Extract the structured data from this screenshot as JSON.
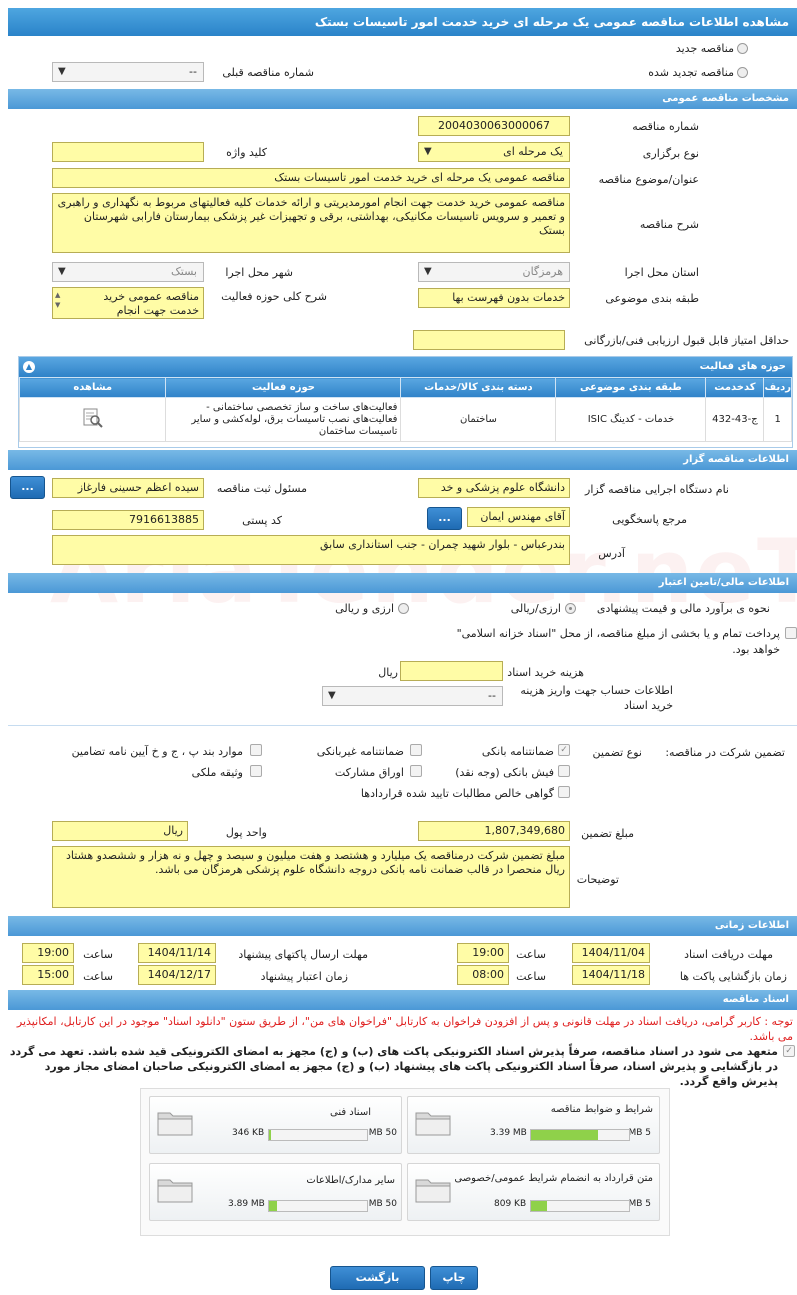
{
  "header": {
    "title": "مشاهده اطلاعات مناقصه عمومی یک مرحله ای خرید خدمت امور تاسیسات بستک"
  },
  "top": {
    "new_label": "مناقصه جدید",
    "renewed_label": "مناقصه تجدید شده",
    "prev_number_label": "شماره مناقصه قبلی",
    "prev_number_value": "--"
  },
  "general": {
    "section_title": "مشخصات مناقصه عمومی",
    "number_label": "شماره مناقصه",
    "number_value": "2004030063000067",
    "type_label": "نوع برگزاری",
    "type_value": "یک مرحله ای",
    "keyword_label": "کلید واژه",
    "keyword_value": "",
    "subject_label": "عنوان/موضوع مناقصه",
    "subject_value": "مناقصه عمومی یک مرحله ای خرید خدمت امور تاسیسات بستک",
    "desc_label": "شرح مناقصه",
    "desc_value": "مناقصه عمومی خرید خدمت جهت انجام امورمدیریتی و ارائه خدمات کلیه فعالیتهای مربوط به  نگهداری و راهبری و تعمیر و سرویس تاسیسات مکانیکی، بهداشتی، برقی و تجهیزات غیر پزشکی بیمارستان فارابی شهرستان بستک",
    "province_label": "استان محل اجرا",
    "province_value": "هرمزگان",
    "city_label": "شهر محل اجرا",
    "city_value": "بستک",
    "category_label": "طبقه بندی موضوعی",
    "category_value": "خدمات بدون فهرست بها",
    "scope_label": "شرح کلی حوزه فعالیت",
    "scope_value": "مناقصه عمومی خرید خدمت جهت انجام",
    "min_score_label": "حداقل امتیاز قابل قبول ارزیابی فنی/بازرگانی",
    "min_score_value": ""
  },
  "activity": {
    "title": "حوزه های فعالیت",
    "columns": [
      "ردیف",
      "کدخدمت",
      "طبقه بندی موضوعی",
      "دسته بندی کالا/خدمات",
      "حوزه فعالیت",
      "مشاهده"
    ],
    "rows": [
      {
        "index": "1",
        "code": "ج-43-432",
        "category": "خدمات - کدینگ ISIC",
        "group": "ساختمان",
        "field": "فعالیت‌های ساخت و ساز تخصصی ساختمانی - فعالیت‌های نصب تاسیسات برق، لوله‌کشی و سایر تاسیسات ساختمان"
      }
    ]
  },
  "organizer": {
    "section_title": "اطلاعات مناقصه گزار",
    "agency_label": "نام دستگاه اجرایی مناقصه گزار",
    "agency_value": "دانشگاه علوم پزشکی و خد",
    "registrar_label": "مسئول ثبت مناقصه",
    "registrar_value": "سیده اعظم حسینی فارغاز",
    "ref_label": "مرجع پاسخگویی",
    "ref_value": "آقای مهندس ایمان",
    "postal_label": "کد پستی",
    "postal_value": "7916613885",
    "address_label": "آدرس",
    "address_value": "بندرعباس - بلوار شهید چمران - جنب استانداری سابق",
    "more_btn": "..."
  },
  "finance": {
    "section_title": "اطلاعات مالی/تامین اعتبار",
    "estimate_label": "نحوه ی برآورد مالی و قیمت پیشنهادی",
    "opt_rial": "ارزی/ریالی",
    "opt_mixed": "ارزی و ریالی",
    "treasury_text": "پرداخت تمام و یا بخشی از مبلغ مناقصه، از محل \"اسناد خزانه اسلامی\" خواهد بود.",
    "doc_cost_label": "هزینه خرید اسناد",
    "doc_cost_value": "",
    "doc_cost_unit": "ریال",
    "account_label": "اطلاعات حساب جهت واریز هزینه خرید اسناد",
    "account_value": "--"
  },
  "guarantee": {
    "label": "تضمین شرکت در مناقصه:",
    "type_label": "نوع تضمین",
    "options": [
      "ضمانتنامه بانکی",
      "ضمانتنامه غیربانکی",
      "موارد بند پ ، ج و خ آیین نامه تضامین",
      "فیش بانکی (وجه نقد)",
      "اوراق مشارکت",
      "وثیقه ملکی",
      "گواهی خالص مطالبات تایید شده قراردادها"
    ],
    "amount_label": "مبلغ تضمین",
    "amount_value": "1,807,349,680",
    "currency_label": "واحد پول",
    "currency_value": "ریال",
    "notes_label": "توضیحات",
    "notes_value": "مبلغ تضمین شرکت درمناقصه یک میلیارد و هشتصد و هفت میلیون و سیصد و چهل و نه هزار و ششصدو هشتاد ریال منحصرا در قالب ضمانت نامه بانکی دروجه دانشگاه علوم پزشکی هرمزگان می باشد."
  },
  "timing": {
    "section_title": "اطلاعات زمانی",
    "receive_label": "مهلت دریافت اسناد",
    "receive_date": "1404/11/04",
    "receive_time": "19:00",
    "submit_label": "مهلت ارسال پاکتهای پیشنهاد",
    "submit_date": "1404/11/14",
    "submit_time": "19:00",
    "open_label": "زمان بازگشایی پاکت ها",
    "open_date": "1404/11/18",
    "open_time": "08:00",
    "valid_label": "زمان اعتبار پیشنهاد",
    "valid_date": "1404/12/17",
    "valid_time": "15:00",
    "time_label": "ساعت"
  },
  "docs": {
    "section_title": "اسناد مناقصه",
    "notice": "توجه : کاربر گرامی، دریافت اسناد در مهلت قانونی و پس از افزودن فراخوان به کارتابل \"فراخوان های من\"، از طریق ستون \"دانلود اسناد\" موجود در این کارتابل، امکانپذیر می باشد.",
    "commit": "متعهد می شود در اسناد مناقصه، صرفاً پذیرش اسناد الکترونیکی پاکت های (ب) و (ج) مجهز به امضای الکترونیکی قید شده باشد. تعهد می گردد در بازگشایی و پذیرش اسناد، صرفاً اسناد الکترونیکی پاکت های پیشنهاد (ب) و (ج) مجهز به امضای الکترونیکی صاحبان امضای مجاز مورد پذیرش واقع گردد.",
    "cards": [
      {
        "title": "شرایط و ضوابط مناقصه",
        "used": "3.39 MB",
        "limit": "5 MB",
        "ratio": 0.68
      },
      {
        "title": "اسناد فنی",
        "used": "346 KB",
        "limit": "50 MB",
        "ratio": 0.01
      },
      {
        "title": "متن قرارداد به انضمام شرایط عمومی/خصوصی",
        "used": "809 KB",
        "limit": "5 MB",
        "ratio": 0.16
      },
      {
        "title": "سایر مدارک/اطلاعات",
        "used": "3.89 MB",
        "limit": "50 MB",
        "ratio": 0.08
      }
    ]
  },
  "footer": {
    "print": "چاپ",
    "back": "بازگشت"
  },
  "watermark": "AriaTender.neT",
  "colors": {
    "header": "#2a83c9",
    "field": "#fffca6",
    "progress": "#8fd14a"
  }
}
